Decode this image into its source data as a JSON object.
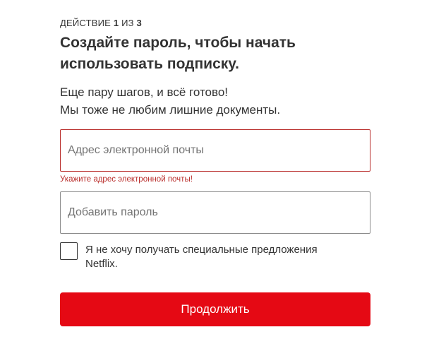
{
  "step": {
    "prefix": "ДЕЙСТВИЕ",
    "current": "1",
    "separator": "ИЗ",
    "total": "3"
  },
  "title": "Создайте пароль, чтобы начать использовать подписку.",
  "subtitle": {
    "line1": "Еще пару шагов, и всё готово!",
    "line2": "Мы тоже не любим лишние документы."
  },
  "email": {
    "placeholder": "Адрес электронной почты",
    "value": "",
    "error": "Укажите адрес электронной почты!"
  },
  "password": {
    "placeholder": "Добавить пароль",
    "value": ""
  },
  "offers_checkbox": {
    "label": "Я не хочу получать специальные предложения Netflix.",
    "checked": false
  },
  "continue_button": {
    "label": "Продолжить"
  },
  "colors": {
    "accent": "#e50914",
    "error": "#b92d2b",
    "text": "#333333"
  }
}
